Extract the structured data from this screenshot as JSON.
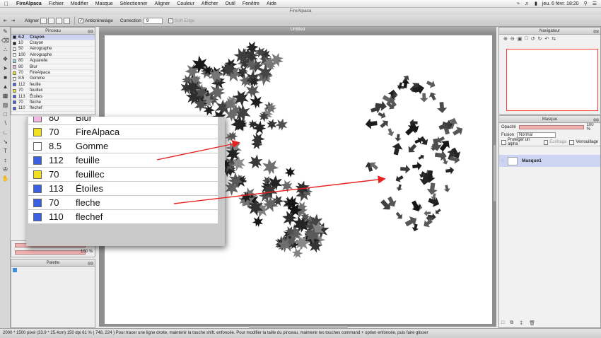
{
  "menubar": {
    "app": "FireAlpaca",
    "items": [
      "Fichier",
      "Modifier",
      "Masque",
      "Sélectionner",
      "Aligner",
      "Couleur",
      "Afficher",
      "Outil",
      "Fenêtre",
      "Aide"
    ],
    "clock": "jeu. 6 févr.  18:20"
  },
  "window_title": "FireAlpaca",
  "toolbar": {
    "align_label": "Aligner",
    "antialias_label": "Anticrénelage",
    "correction_label": "Correction",
    "correction_value": "9",
    "soft_edge_label": "Soft Edge"
  },
  "brush_panel": {
    "title": "Pinceau",
    "items": [
      {
        "size": "6.2",
        "name": "Crayon",
        "color": "#222222"
      },
      {
        "size": "10",
        "name": "Crayon",
        "color": "#222222"
      },
      {
        "size": "50",
        "name": "Aérographe",
        "color": "#ffffff"
      },
      {
        "size": "100",
        "name": "Aérographe",
        "color": "#ffffff"
      },
      {
        "size": "80",
        "name": "Aquarelle",
        "color": "#8fd6e8"
      },
      {
        "size": "80",
        "name": "Blur",
        "color": "#f2b6e3"
      },
      {
        "size": "70",
        "name": "FireAlpaca",
        "color": "#f0e020"
      },
      {
        "size": "8.5",
        "name": "Gomme",
        "color": "#ffffff"
      },
      {
        "size": "112",
        "name": "feuille",
        "color": "#3a5fe0"
      },
      {
        "size": "70",
        "name": "feuillec",
        "color": "#f0e020"
      },
      {
        "size": "113",
        "name": "Étoiles",
        "color": "#3a5fe0"
      },
      {
        "size": "70",
        "name": "fleche",
        "color": "#3a5fe0"
      },
      {
        "size": "110",
        "name": "flechef",
        "color": "#3a5fe0"
      }
    ]
  },
  "zoom_panel": {
    "items": [
      {
        "size": "80",
        "name": "Blur",
        "color": "#f2b6e3"
      },
      {
        "size": "70",
        "name": "FireAlpaca",
        "color": "#f0e020"
      },
      {
        "size": "8.5",
        "name": "Gomme",
        "color": "#ffffff"
      },
      {
        "size": "112",
        "name": "feuille",
        "color": "#3a5fe0"
      },
      {
        "size": "70",
        "name": "feuillec",
        "color": "#f0e020"
      },
      {
        "size": "113",
        "name": "Étoiles",
        "color": "#3a5fe0"
      },
      {
        "size": "70",
        "name": "fleche",
        "color": "#3a5fe0"
      },
      {
        "size": "110",
        "name": "flechef",
        "color": "#3a5fe0"
      }
    ]
  },
  "canvas": {
    "tab_title": "Untitled"
  },
  "navigator": {
    "title": "Navigateur"
  },
  "layer_panel": {
    "title": "Masque",
    "opacity_label": "Opacité",
    "opacity_value": "100 %",
    "blend_label": "Fusion",
    "blend_value": "Normal",
    "protect_alpha": "Protéger un alpha",
    "clipping": "Écrêtage",
    "lock": "Verrouillage",
    "layer_name": "Masque1"
  },
  "lower_left": {
    "size_value": "6",
    "opacity_value": "100 %",
    "palette_title": "Palette"
  },
  "status": "2000 * 1500 pixel   (33.9 * 25.4cm)   150 dpi   61 %   ( 748, 224 )   Pour tracer une ligne droite, maintenir la touche shift. enfoncée. Pour modifier la taille du pinceau, maintenir les touches command + option enfoncée, puis faire glisser",
  "colors": {
    "annotation_arrow": "#e82020",
    "selection": "#cdd3f3",
    "canvas_bg": "#8e8e8e"
  }
}
